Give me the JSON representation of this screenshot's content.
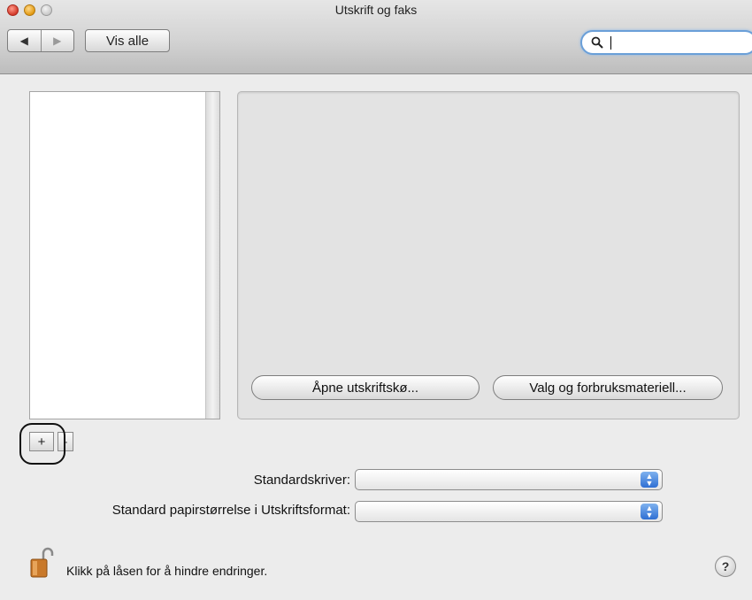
{
  "window": {
    "title": "Utskrift og faks"
  },
  "toolbar": {
    "back_glyph": "◀",
    "forward_glyph": "▶",
    "show_all_label": "Vis alle",
    "search_placeholder": "",
    "search_value": "",
    "search_icon": "search-icon"
  },
  "printer_list": {
    "items": [],
    "add_label": "+",
    "remove_label": "-"
  },
  "detail": {
    "open_queue_label": "Åpne utskriftskø...",
    "options_label": "Valg og forbruksmateriell..."
  },
  "settings": {
    "default_printer_label": "Standardskriver:",
    "default_printer_value": "",
    "default_paper_label": "Standard papirstørrelse i Utskriftsformat:",
    "default_paper_value": ""
  },
  "footer": {
    "lock_text": "Klikk på låsen for å hindre endringer.",
    "lock_icon": "unlocked-padlock-icon",
    "help_label": "?"
  },
  "colors": {
    "accent": "#2f6fd3",
    "window_bg": "#ececec"
  }
}
